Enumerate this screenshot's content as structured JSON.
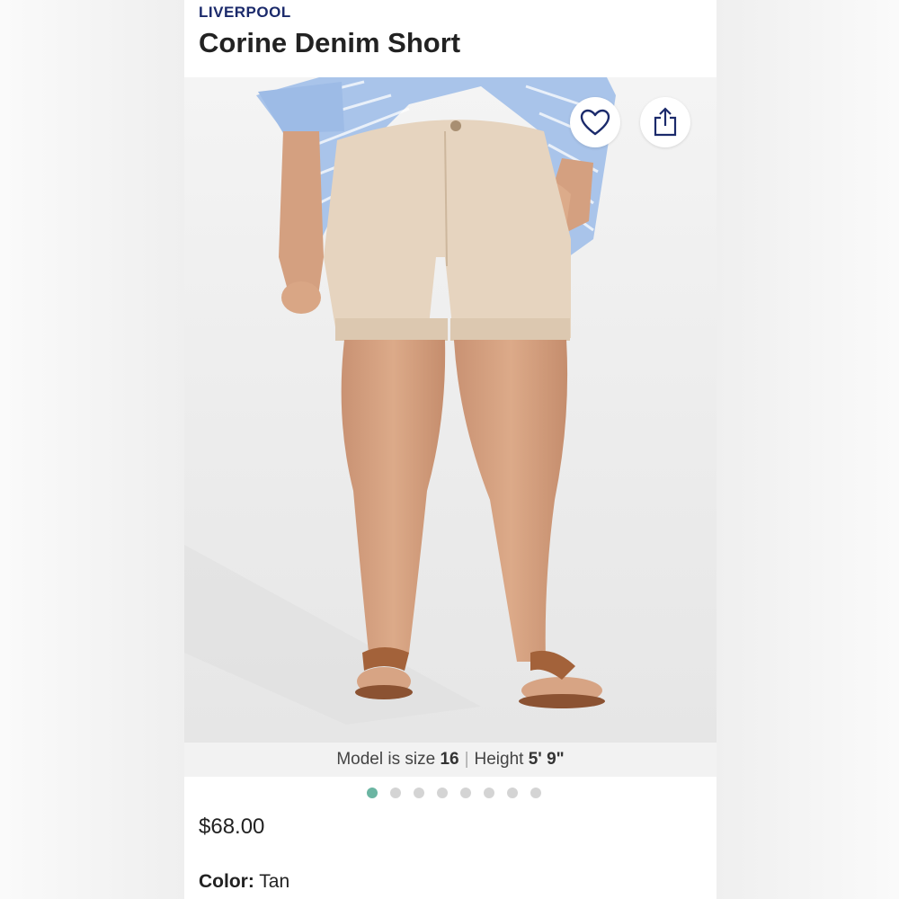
{
  "product": {
    "brand": "LIVERPOOL",
    "title": "Corine Denim Short",
    "price": "$68.00",
    "color_label": "Color:",
    "color_value": "Tan"
  },
  "gallery": {
    "caption": {
      "model_prefix": "Model is size",
      "model_size": "16",
      "separator": "|",
      "height_prefix": "Height",
      "height_value": "5' 9\""
    },
    "dots_count": 8,
    "active_dot": 1,
    "favorite_icon": "heart-icon",
    "share_icon": "share-icon"
  },
  "colors": {
    "brand": "#1b2a6b",
    "active_dot": "#6bb5a2",
    "inactive_dot": "#d4d4d4",
    "shorts": "#e4d2bd",
    "shirt": "#8fb4e0",
    "skin": "#d9a683",
    "sandal": "#a3623a"
  }
}
